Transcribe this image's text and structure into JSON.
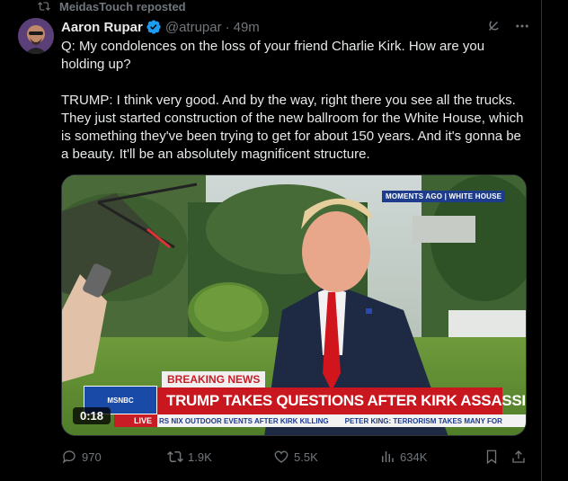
{
  "repost": {
    "label": "MeidasTouch reposted",
    "icon": "repost-icon"
  },
  "author": {
    "name": "Aaron Rupar",
    "handle": "@atrupar",
    "time": "49m",
    "verified_color": "#1d9bf0"
  },
  "tweet": {
    "question": "Q: My condolences on the loss of your friend Charlie Kirk. How are you holding up?",
    "answer": "TRUMP: I think very good. And by the way, right there you see all the trucks. They just started construction of the new ballroom for the White House, which is something they've been trying to get for about 150 years. And it's gonna be a beauty. It'll be an absolutely magnificent structure."
  },
  "video": {
    "tag": "MOMENTS AGO | WHITE HOUSE",
    "breaking": "BREAKING NEWS",
    "headline": "TRUMP TAKES QUESTIONS AFTER KIRK ASSASSINATION",
    "ticker_1": "RS NIX OUTDOOR EVENTS AFTER KIRK KILLING",
    "ticker_2": "PETER KING: TERRORISM TAKES MANY FOR",
    "logo": "MSNBC",
    "live": "LIVE",
    "timestamp": "0:18"
  },
  "actions": {
    "replies": "970",
    "reposts": "1.9K",
    "likes": "5.5K",
    "views": "634K"
  },
  "colors": {
    "accent": "#1d9bf0",
    "muted": "#71767b",
    "text": "#e7e9ea",
    "breaking_red": "#c9171f"
  }
}
